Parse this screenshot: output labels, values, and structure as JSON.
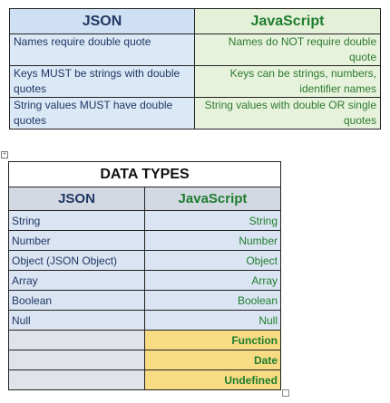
{
  "comparison_table": {
    "headers": {
      "json": "JSON",
      "javascript": "JavaScript"
    },
    "rows": [
      {
        "json": "Names require double quote",
        "javascript": "Names do NOT require double quote"
      },
      {
        "json": "Keys MUST be strings with double quotes",
        "javascript": "Keys can be strings, numbers, identifier names"
      },
      {
        "json": "String values MUST have double quotes",
        "javascript": "String values with double OR single quotes"
      }
    ]
  },
  "data_types_table": {
    "title": "DATA TYPES",
    "headers": {
      "json": "JSON",
      "javascript": "JavaScript"
    },
    "rows": [
      {
        "json": "String",
        "javascript": "String"
      },
      {
        "json": "Number",
        "javascript": "Number"
      },
      {
        "json": "Object (JSON Object)",
        "javascript": "Object"
      },
      {
        "json": "Array",
        "javascript": "Array"
      },
      {
        "json": "Boolean",
        "javascript": "Boolean"
      },
      {
        "json": "Null",
        "javascript": "Null"
      },
      {
        "json": "",
        "javascript": "Function"
      },
      {
        "json": "",
        "javascript": "Date"
      },
      {
        "json": "",
        "javascript": "Undefined"
      }
    ]
  },
  "colors": {
    "json_text": "#1f3864",
    "js_text": "#1e7d2e",
    "js_only_highlight": "#f8dc83"
  }
}
